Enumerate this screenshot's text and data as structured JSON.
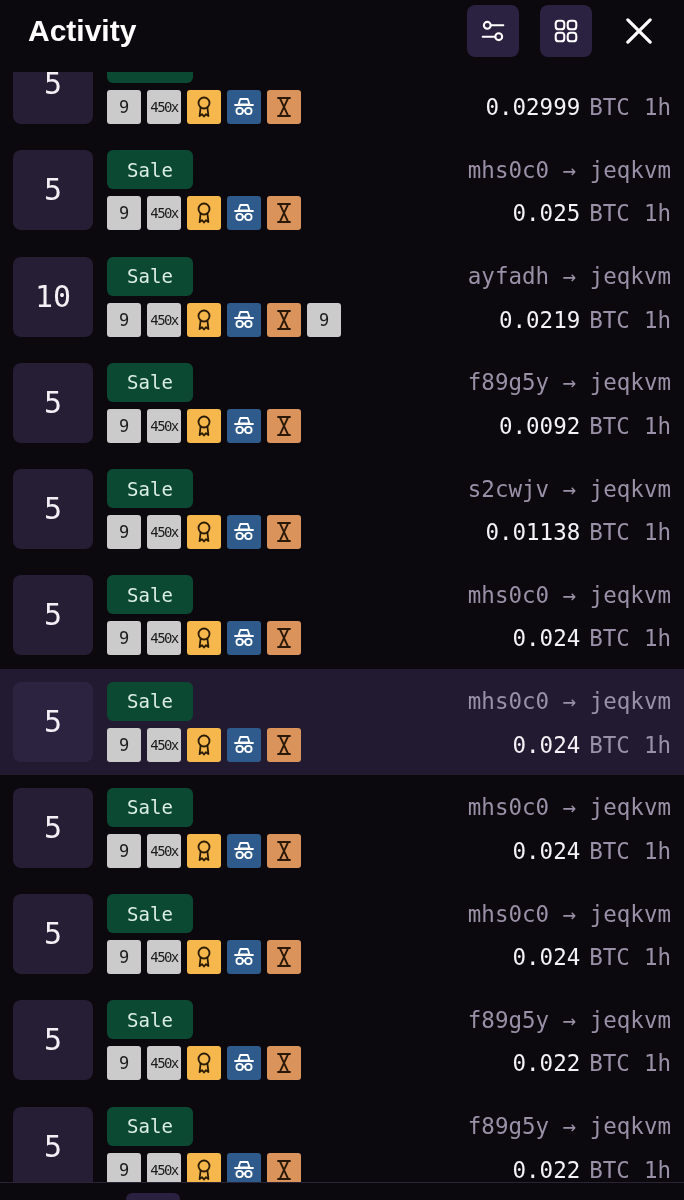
{
  "header": {
    "title": "Activity",
    "buttons": [
      {
        "kind": "filter"
      },
      {
        "kind": "grid"
      },
      {
        "kind": "close"
      }
    ]
  },
  "rows": [
    {
      "partial": true,
      "selected": false,
      "quantity": "5",
      "badges": [
        {
          "kind": "number",
          "text": "9"
        },
        {
          "kind": "multiplier",
          "text": "450x"
        },
        {
          "kind": "award"
        },
        {
          "kind": "incognito"
        },
        {
          "kind": "hourglass"
        }
      ],
      "amount": "0.02999",
      "currency": "BTC",
      "time": "1h"
    },
    {
      "partial": false,
      "selected": false,
      "quantity": "5",
      "type": "Sale",
      "route": "mhs0c0 → jeqkvm",
      "badges": [
        {
          "kind": "number",
          "text": "9"
        },
        {
          "kind": "multiplier",
          "text": "450x"
        },
        {
          "kind": "award"
        },
        {
          "kind": "incognito"
        },
        {
          "kind": "hourglass"
        }
      ],
      "amount": "0.025",
      "currency": "BTC",
      "time": "1h"
    },
    {
      "partial": false,
      "selected": false,
      "quantity": "10",
      "type": "Sale",
      "route": "ayfadh → jeqkvm",
      "badges": [
        {
          "kind": "number",
          "text": "9"
        },
        {
          "kind": "multiplier",
          "text": "450x"
        },
        {
          "kind": "award"
        },
        {
          "kind": "incognito"
        },
        {
          "kind": "hourglass"
        },
        {
          "kind": "number",
          "text": "9"
        }
      ],
      "amount": "0.0219",
      "currency": "BTC",
      "time": "1h"
    },
    {
      "partial": false,
      "selected": false,
      "quantity": "5",
      "type": "Sale",
      "route": "f89g5y → jeqkvm",
      "badges": [
        {
          "kind": "number",
          "text": "9"
        },
        {
          "kind": "multiplier",
          "text": "450x"
        },
        {
          "kind": "award"
        },
        {
          "kind": "incognito"
        },
        {
          "kind": "hourglass"
        }
      ],
      "amount": "0.0092",
      "currency": "BTC",
      "time": "1h"
    },
    {
      "partial": false,
      "selected": false,
      "quantity": "5",
      "type": "Sale",
      "route": "s2cwjv → jeqkvm",
      "badges": [
        {
          "kind": "number",
          "text": "9"
        },
        {
          "kind": "multiplier",
          "text": "450x"
        },
        {
          "kind": "award"
        },
        {
          "kind": "incognito"
        },
        {
          "kind": "hourglass"
        }
      ],
      "amount": "0.01138",
      "currency": "BTC",
      "time": "1h"
    },
    {
      "partial": false,
      "selected": false,
      "quantity": "5",
      "type": "Sale",
      "route": "mhs0c0 → jeqkvm",
      "badges": [
        {
          "kind": "number",
          "text": "9"
        },
        {
          "kind": "multiplier",
          "text": "450x"
        },
        {
          "kind": "award"
        },
        {
          "kind": "incognito"
        },
        {
          "kind": "hourglass"
        }
      ],
      "amount": "0.024",
      "currency": "BTC",
      "time": "1h"
    },
    {
      "partial": false,
      "selected": true,
      "quantity": "5",
      "type": "Sale",
      "route": "mhs0c0 → jeqkvm",
      "badges": [
        {
          "kind": "number",
          "text": "9"
        },
        {
          "kind": "multiplier",
          "text": "450x"
        },
        {
          "kind": "award"
        },
        {
          "kind": "incognito"
        },
        {
          "kind": "hourglass"
        }
      ],
      "amount": "0.024",
      "currency": "BTC",
      "time": "1h"
    },
    {
      "partial": false,
      "selected": false,
      "quantity": "5",
      "type": "Sale",
      "route": "mhs0c0 → jeqkvm",
      "badges": [
        {
          "kind": "number",
          "text": "9"
        },
        {
          "kind": "multiplier",
          "text": "450x"
        },
        {
          "kind": "award"
        },
        {
          "kind": "incognito"
        },
        {
          "kind": "hourglass"
        }
      ],
      "amount": "0.024",
      "currency": "BTC",
      "time": "1h"
    },
    {
      "partial": false,
      "selected": false,
      "quantity": "5",
      "type": "Sale",
      "route": "mhs0c0 → jeqkvm",
      "badges": [
        {
          "kind": "number",
          "text": "9"
        },
        {
          "kind": "multiplier",
          "text": "450x"
        },
        {
          "kind": "award"
        },
        {
          "kind": "incognito"
        },
        {
          "kind": "hourglass"
        }
      ],
      "amount": "0.024",
      "currency": "BTC",
      "time": "1h"
    },
    {
      "partial": false,
      "selected": false,
      "quantity": "5",
      "type": "Sale",
      "route": "f89g5y → jeqkvm",
      "badges": [
        {
          "kind": "number",
          "text": "9"
        },
        {
          "kind": "multiplier",
          "text": "450x"
        },
        {
          "kind": "award"
        },
        {
          "kind": "incognito"
        },
        {
          "kind": "hourglass"
        }
      ],
      "amount": "0.022",
      "currency": "BTC",
      "time": "1h"
    },
    {
      "partial": true,
      "selected": false,
      "quantity": "5",
      "type": "Sale",
      "route": "f89g5y → jeqkvm",
      "badges": [
        {
          "kind": "number",
          "text": "9"
        },
        {
          "kind": "multiplier",
          "text": "450x"
        },
        {
          "kind": "award"
        },
        {
          "kind": "incognito"
        },
        {
          "kind": "hourglass"
        }
      ],
      "amount": "0.022",
      "currency": "BTC",
      "time": "1h"
    }
  ]
}
